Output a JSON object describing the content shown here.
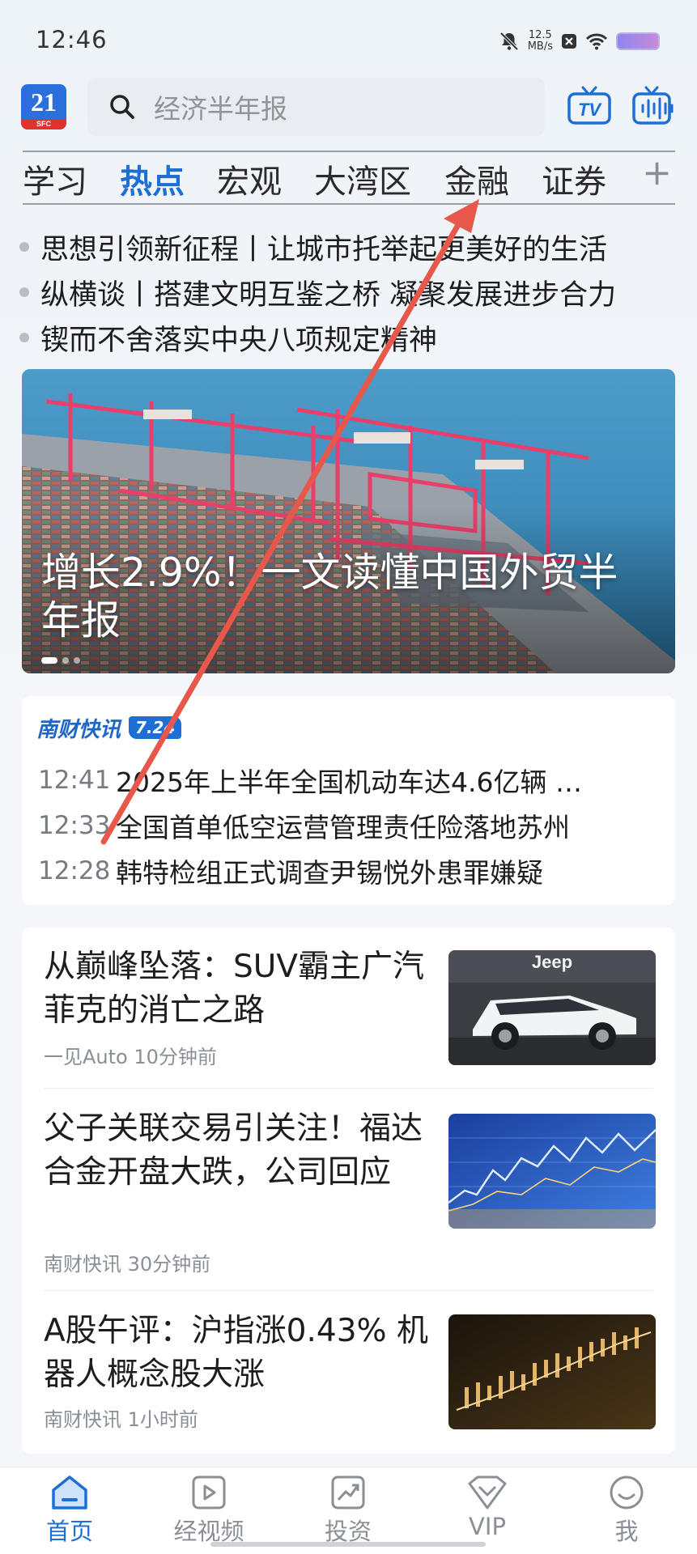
{
  "status_bar": {
    "time": "12:46",
    "net_speed": "12.5",
    "net_unit": "MB/s"
  },
  "header": {
    "logo_text": "21",
    "logo_sub": "SFC",
    "search_placeholder": "经济半年报",
    "tv_icon": "tv-icon",
    "audio_icon": "audio-icon"
  },
  "tabs": {
    "items": [
      {
        "label": "学习",
        "active": false
      },
      {
        "label": "热点",
        "active": true
      },
      {
        "label": "宏观",
        "active": false
      },
      {
        "label": "大湾区",
        "active": false
      },
      {
        "label": "金融",
        "active": false
      },
      {
        "label": "证券",
        "active": false
      }
    ],
    "add_label": "+"
  },
  "headlines": [
    "思想引领新征程丨让城市托举起更美好的生活",
    "纵横谈丨搭建文明互鉴之桥 凝聚发展进步合力",
    "锲而不舍落实中央八项规定精神"
  ],
  "hero": {
    "title": "增长2.9%！一文读懂中国外贸半年报",
    "slide_index": 1,
    "slide_count": 3
  },
  "flash": {
    "brand": "南财快讯",
    "date": "7.24",
    "items": [
      {
        "time": "12:41",
        "headline": "2025年上半年全国机动车达4.6亿辆 …"
      },
      {
        "time": "12:33",
        "headline": "全国首单低空运营管理责任险落地苏州"
      },
      {
        "time": "12:28",
        "headline": "韩特检组正式调查尹锡悦外患罪嫌疑"
      }
    ]
  },
  "news": [
    {
      "title": "从巅峰坠落：SUV霸主广汽菲克的消亡之路",
      "source": "一见Auto",
      "time": "10分钟前",
      "thumb_text": "Jeep"
    },
    {
      "title": "父子关联交易引关注！福达合金开盘大跌，公司回应",
      "source": "南财快讯",
      "time": "30分钟前"
    },
    {
      "title": "A股午评：沪指涨0.43% 机器人概念股大涨",
      "source": "南财快讯",
      "time": "1小时前"
    }
  ],
  "bottom_nav": [
    {
      "label": "首页",
      "icon": "home-icon",
      "active": true
    },
    {
      "label": "经视频",
      "icon": "video-icon",
      "active": false
    },
    {
      "label": "投资",
      "icon": "invest-icon",
      "active": false
    },
    {
      "label": "VIP",
      "icon": "vip-icon",
      "active": false
    },
    {
      "label": "我",
      "icon": "profile-icon",
      "active": false
    }
  ],
  "colors": {
    "accent": "#1d6fd6",
    "annotation": "#e8584a"
  }
}
